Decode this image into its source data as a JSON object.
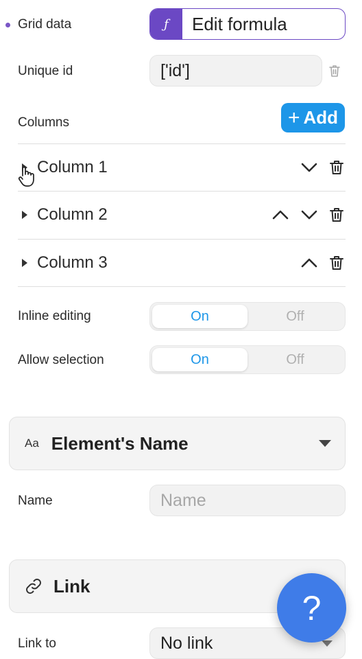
{
  "grid_data": {
    "label": "Grid data",
    "formula_button_label": "Edit formula",
    "formula_icon": "ƒ"
  },
  "unique_id": {
    "label": "Unique id",
    "value": "['id']"
  },
  "columns": {
    "label": "Columns",
    "add_label": "Add",
    "add_icon": "+",
    "items": [
      {
        "name": "Column 1"
      },
      {
        "name": "Column 2"
      },
      {
        "name": "Column 3"
      }
    ]
  },
  "inline_editing": {
    "label": "Inline editing",
    "on": "On",
    "off": "Off",
    "selected": "On"
  },
  "allow_selection": {
    "label": "Allow selection",
    "on": "On",
    "off": "Off",
    "selected": "On"
  },
  "element_name_section": {
    "icon_text": "Aa",
    "title": "Element's Name"
  },
  "name_field": {
    "label": "Name",
    "placeholder": "Name"
  },
  "link_section": {
    "title": "Link"
  },
  "link_to": {
    "label": "Link to",
    "value": "No link"
  },
  "help_button": {
    "label": "?"
  },
  "colors": {
    "accent_purple": "#6b48c4",
    "accent_blue": "#1d96e8",
    "help_blue": "#3f7ce8"
  }
}
